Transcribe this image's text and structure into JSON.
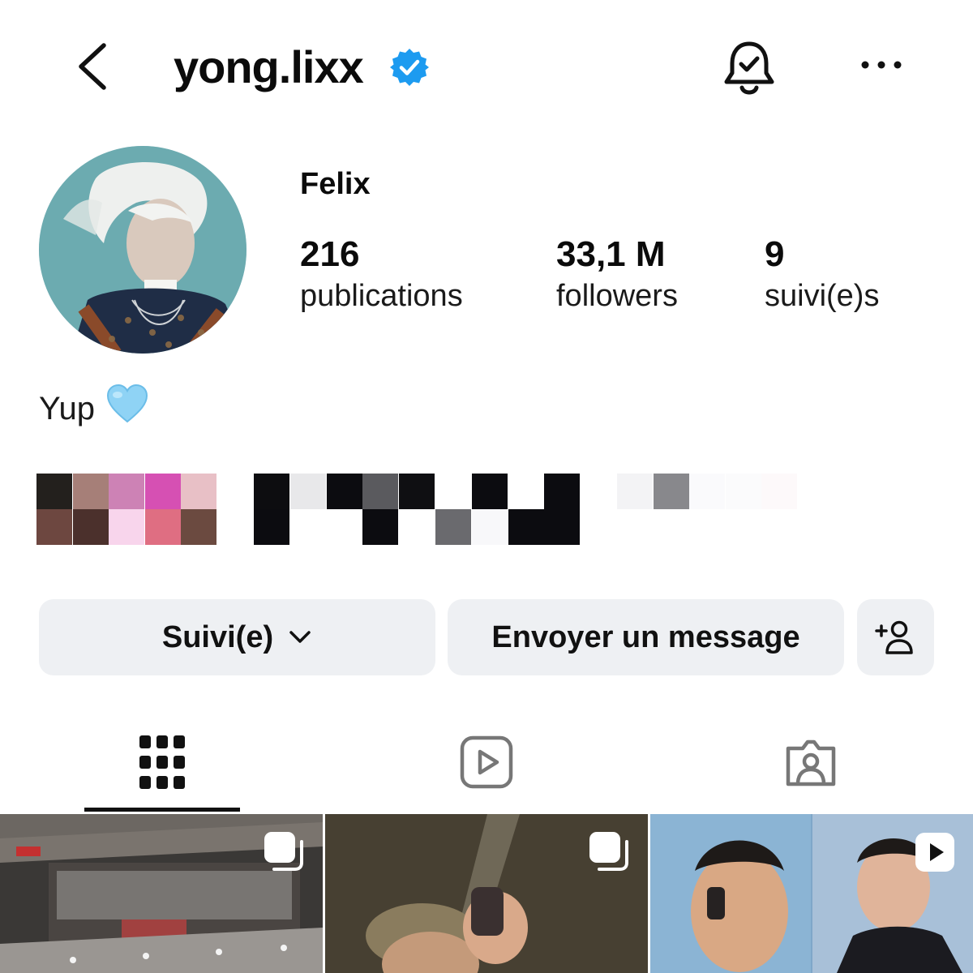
{
  "header": {
    "username": "yong.lixx",
    "verified_icon": "verified-badge-icon",
    "back_icon": "chevron-left-icon",
    "notify_icon": "bell-check-icon",
    "more_icon": "more-horizontal-icon"
  },
  "profile": {
    "display_name": "Felix",
    "stats": [
      {
        "value": "216",
        "label": "publications"
      },
      {
        "value": "33,1 M",
        "label": "followers"
      },
      {
        "value": "9",
        "label": "suivi(e)s"
      }
    ],
    "bio_text": "Yup",
    "bio_emoji": "🩵"
  },
  "actions": {
    "follow_label": "Suivi(e)",
    "message_label": "Envoyer un message",
    "add_user_icon": "add-person-icon"
  },
  "tabs": [
    {
      "icon": "grid-icon",
      "active": true
    },
    {
      "icon": "reels-play-icon",
      "active": false
    },
    {
      "icon": "tagged-person-icon",
      "active": false
    }
  ],
  "colors": {
    "verified_blue": "#1d9bf0",
    "button_bg": "#eef0f3",
    "text_primary": "#0b0b0b"
  }
}
